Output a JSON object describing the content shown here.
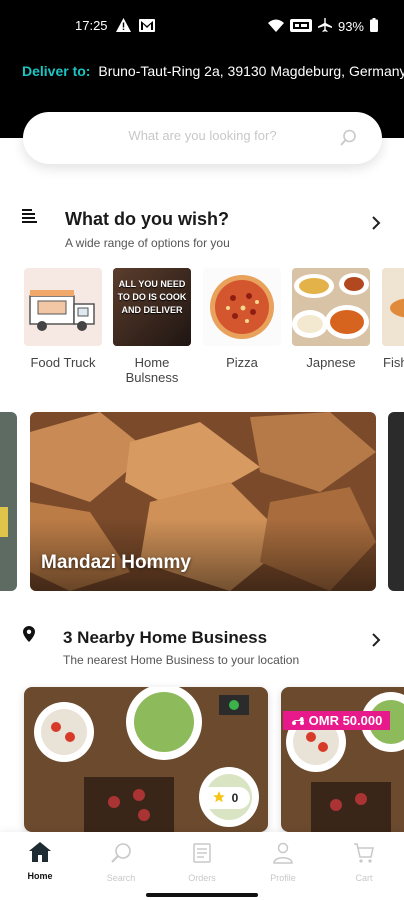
{
  "status_bar": {
    "time": "17:25",
    "battery": "93%"
  },
  "header": {
    "deliver_label": "Deliver to:",
    "address": "Bruno-Taut-Ring 2a, 39130 Magdeburg, Germany"
  },
  "search": {
    "placeholder": "What are you looking for?"
  },
  "wish_section": {
    "title": "What do you wish?",
    "subtitle": "A wide range of options for you"
  },
  "categories": [
    {
      "label": "Food Truck"
    },
    {
      "label": "Home Bulsness"
    },
    {
      "label": "Pizza"
    },
    {
      "label": "Japnese"
    },
    {
      "label": "Fish"
    }
  ],
  "category_thumb_text": "ALL YOU NEED TO DO IS COOK AND DELIVER",
  "banner": {
    "caption": "Mandazi Hommy"
  },
  "nearby_section": {
    "title": "3 Nearby Home Business",
    "subtitle": "The nearest Home Business to your location"
  },
  "cards": [
    {
      "rating": "0"
    },
    {
      "price": "OMR 50.000"
    }
  ],
  "bottom_nav": [
    {
      "label": "Home",
      "active": true
    },
    {
      "label": "Search"
    },
    {
      "label": "Orders"
    },
    {
      "label": "Profile"
    },
    {
      "label": "Cart"
    }
  ],
  "colors": {
    "accent": "#19c6c3",
    "badge": "#e8198b",
    "header_bg": "#000000"
  }
}
